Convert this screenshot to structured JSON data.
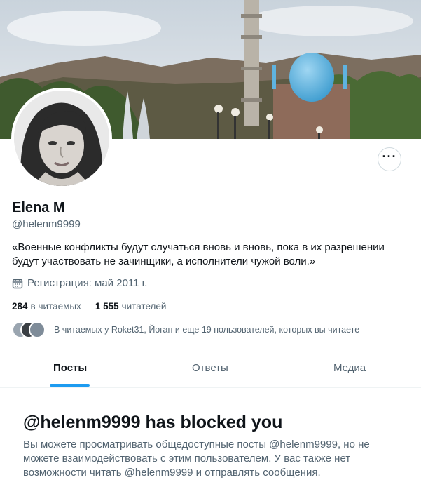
{
  "profile": {
    "name": "Elena M",
    "handle": "@helenm9999",
    "bio": "«Военные конфликты будут случаться вновь и вновь, пока в их разрешении будут участвовать не зачинщики, а исполнители чужой воли.»",
    "joined": "Регистрация: май 2011 г."
  },
  "stats": {
    "following_count": "284",
    "following_label": "в читаемых",
    "followers_count": "1 555",
    "followers_label": "читателей"
  },
  "followed_by": {
    "text": "В читаемых у Roket31, Йоган и еще 19 пользователей, которых вы читаете"
  },
  "tabs": [
    {
      "label": "Посты",
      "active": true
    },
    {
      "label": "Ответы",
      "active": false
    },
    {
      "label": "Медиа",
      "active": false
    }
  ],
  "blocked": {
    "title": "@helenm9999 has blocked you",
    "text": "Вы можете просматривать общедоступные посты @helenm9999, но не можете взаимодействовать с этим пользователем. У вас также нет возможности читать @helenm9999 и отправлять сообщения."
  },
  "colors": {
    "accent": "#1d9bf0",
    "secondary_text": "#536471",
    "primary_text": "#0f1419"
  },
  "icons": {
    "more": "more-horizontal-icon",
    "calendar": "calendar-icon"
  }
}
